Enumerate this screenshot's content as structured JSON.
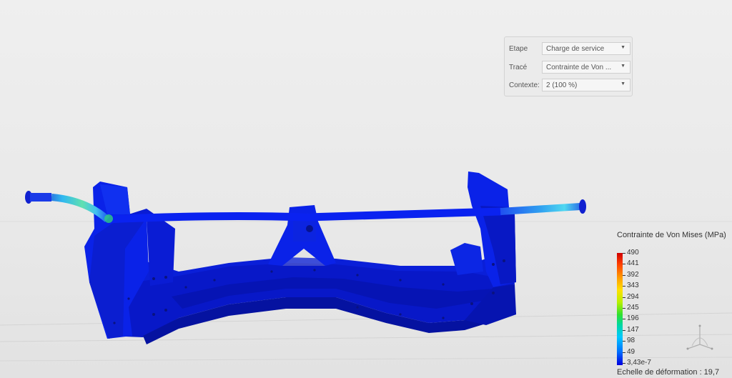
{
  "panel": {
    "rows": [
      {
        "label": "Etape",
        "value": "Charge de service"
      },
      {
        "label": "Tracé",
        "value": "Contrainte de Von ..."
      },
      {
        "label": "Contexte:",
        "value": "2 (100 %)"
      }
    ]
  },
  "legend": {
    "title": "Contrainte de Von Mises (MPa)",
    "ticks": [
      "490",
      "441",
      "392",
      "343",
      "294",
      "245",
      "196",
      "147",
      "98",
      "49",
      "3,43e-7"
    ],
    "colors": [
      "#d00000",
      "#ff9c00",
      "#ffe000",
      "#30e030",
      "#00c8ff",
      "#0000e0"
    ]
  },
  "scale": {
    "text": "Echelle de déformation : 19,7"
  },
  "icons": {
    "dropdown": "chevron-down-icon",
    "triad": "view-triad-icon"
  }
}
